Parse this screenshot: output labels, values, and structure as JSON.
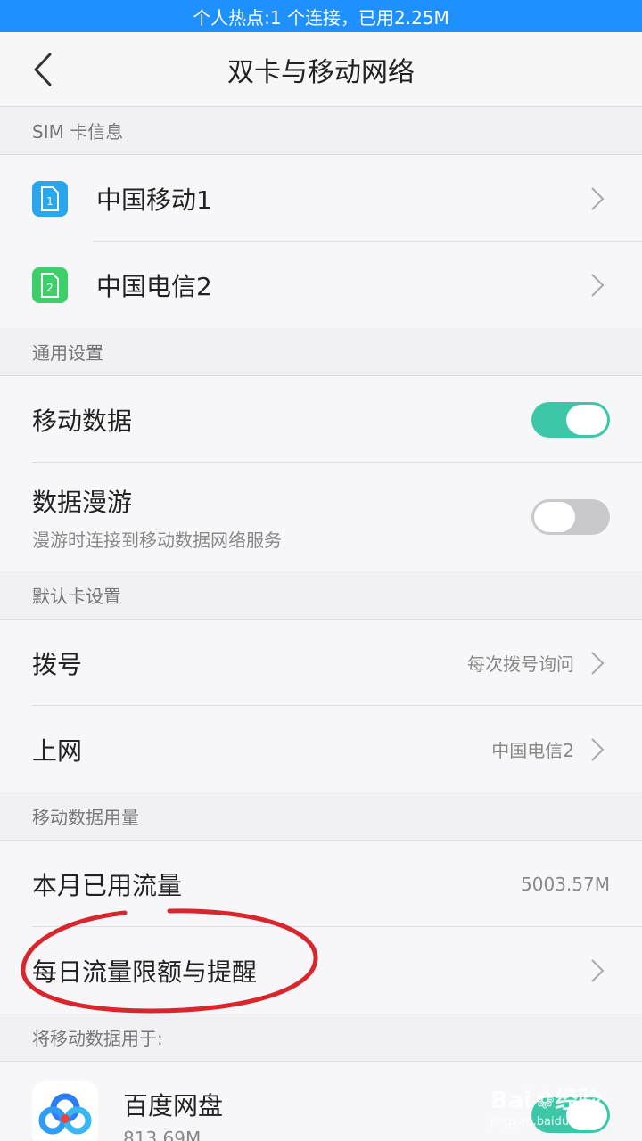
{
  "status_bar": {
    "text": "个人热点:1 个连接，已用2.25M"
  },
  "nav": {
    "title": "双卡与移动网络"
  },
  "sections": {
    "sim": "SIM 卡信息",
    "general": "通用设置",
    "default_card": "默认卡设置",
    "data_usage": "移动数据用量",
    "use_data_for": "将移动数据用于:"
  },
  "sim_cards": [
    {
      "label": "中国移动1",
      "slot": "1",
      "color": "#2aa6ef"
    },
    {
      "label": "中国电信2",
      "slot": "2",
      "color": "#3ccf6a"
    }
  ],
  "general": {
    "mobile_data": {
      "label": "移动数据",
      "enabled": true
    },
    "roaming": {
      "label": "数据漫游",
      "sub": "漫游时连接到移动数据网络服务",
      "enabled": false
    }
  },
  "default_card": {
    "dial": {
      "label": "拨号",
      "value": "每次拨号询问"
    },
    "internet": {
      "label": "上网",
      "value": "中国电信2"
    }
  },
  "data_usage": {
    "monthly": {
      "label": "本月已用流量",
      "value": "5003.57M"
    },
    "daily_limit": {
      "label": "每日流量限额与提醒"
    }
  },
  "apps": [
    {
      "name": "百度网盘",
      "usage": "813.69M",
      "enabled": true
    }
  ],
  "watermark": {
    "brand": "Bai",
    "suffix": "经验",
    "url": "jingyan.baidu.com"
  },
  "colors": {
    "accent": "#3cc7a8",
    "status_bar": "#1e90ff",
    "annotation": "#d9262c"
  }
}
